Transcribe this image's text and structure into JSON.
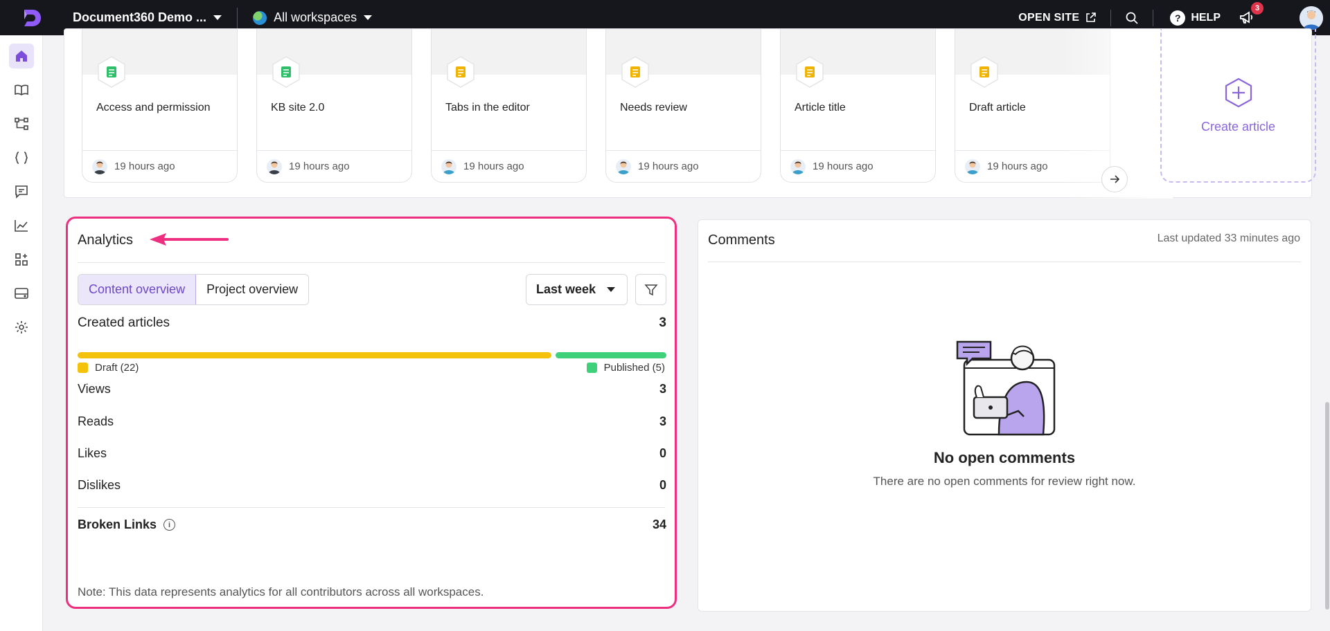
{
  "topbar": {
    "project_name": "Document360 Demo ...",
    "workspace": "All workspaces",
    "open_site": "OPEN SITE",
    "help": "HELP",
    "notification_count": "3"
  },
  "sidebar": {
    "items": [
      "home-icon",
      "book-icon",
      "hierarchy-icon",
      "api-braces-icon",
      "comment-icon",
      "analytics-icon",
      "apps-icon",
      "drive-icon",
      "settings-icon"
    ],
    "active": "home"
  },
  "articles": {
    "cards": [
      {
        "title": "Access and permission",
        "time": "19 hours ago",
        "status": "published"
      },
      {
        "title": "KB site 2.0",
        "time": "19 hours ago",
        "status": "published"
      },
      {
        "title": "Tabs in the editor",
        "time": "19 hours ago",
        "status": "draft"
      },
      {
        "title": "Needs review",
        "time": "19 hours ago",
        "status": "draft"
      },
      {
        "title": "Article title",
        "time": "19 hours ago",
        "status": "draft"
      },
      {
        "title": "Draft article",
        "time": "19 hours ago",
        "status": "draft"
      }
    ],
    "create_label": "Create article"
  },
  "analytics": {
    "title": "Analytics",
    "tabs": [
      "Content overview",
      "Project overview"
    ],
    "active_tab": "Content overview",
    "period": "Last week",
    "created_label": "Created articles",
    "created_value": "3",
    "draft_legend": "Draft (22)",
    "published_legend": "Published (5)",
    "draft_share": 0.81,
    "published_share": 0.19,
    "metrics": [
      {
        "label": "Views",
        "value": "3"
      },
      {
        "label": "Reads",
        "value": "3"
      },
      {
        "label": "Likes",
        "value": "0"
      },
      {
        "label": "Dislikes",
        "value": "0"
      }
    ],
    "broken_links_label": "Broken Links",
    "broken_links_value": "34",
    "note": "Note: This data represents analytics for all contributors across all workspaces."
  },
  "comments": {
    "title": "Comments",
    "updated": "Last updated 33 minutes ago",
    "empty_title": "No open comments",
    "empty_text": "There are no open comments for review right now."
  },
  "colors": {
    "accent": "#7c4ddb",
    "draft": "#f5c20b",
    "published": "#3fd07a",
    "highlight": "#ee2f7f",
    "topbar": "#16161d"
  }
}
